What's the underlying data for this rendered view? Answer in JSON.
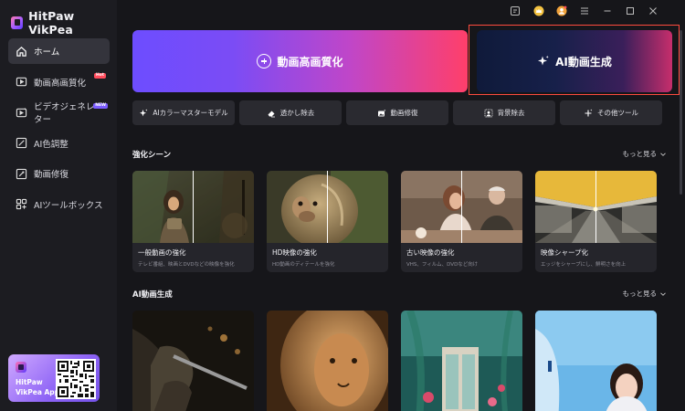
{
  "app": {
    "title": "HitPaw VikPea"
  },
  "sidebar": {
    "items": [
      {
        "label": "ホーム",
        "icon": "home-icon",
        "active": true
      },
      {
        "label": "動画高画質化",
        "icon": "video-enhance-icon",
        "badge": "Hot"
      },
      {
        "label": "ビデオジェネレーター",
        "icon": "video-generator-icon",
        "badge": "NEW"
      },
      {
        "label": "AI色調整",
        "icon": "color-adjust-icon"
      },
      {
        "label": "動画修復",
        "icon": "video-repair-icon"
      },
      {
        "label": "AIツールボックス",
        "icon": "toolbox-icon"
      }
    ],
    "app_card": {
      "line1": "HitPaw",
      "line2": "VikPea App"
    }
  },
  "hero": {
    "enhance_label": "動画高画質化",
    "generate_label": "AI動画生成"
  },
  "tools": [
    {
      "label": "AIカラーマスターモデル",
      "icon": "sparkle-icon"
    },
    {
      "label": "透かし除去",
      "icon": "eraser-icon"
    },
    {
      "label": "動画修復",
      "icon": "image-repair-icon"
    },
    {
      "label": "背景除去",
      "icon": "background-remove-icon"
    },
    {
      "label": "その他ツール",
      "icon": "more-tools-icon"
    }
  ],
  "section_enhance": {
    "title": "強化シーン",
    "more": "もっと見る",
    "cards": [
      {
        "title": "一般動画の強化",
        "desc": "テレビ番組、映画とDVDなどの映像を強化"
      },
      {
        "title": "HD映像の強化",
        "desc": "HD動画のディテールを強化"
      },
      {
        "title": "古い映像の強化",
        "desc": "VHS、フィルム、DVDなど向け"
      },
      {
        "title": "映像シャープ化",
        "desc": "エッジをシャープにし、鮮明さを向上"
      }
    ]
  },
  "section_generate": {
    "title": "AI動画生成",
    "more": "もっと見る"
  },
  "colors": {
    "background": "#16161a",
    "sidebar": "#1c1c21",
    "accent_purple": "#7b4cf5",
    "accent_pink": "#ff3f6a",
    "highlight_border": "#ff4b3e"
  }
}
